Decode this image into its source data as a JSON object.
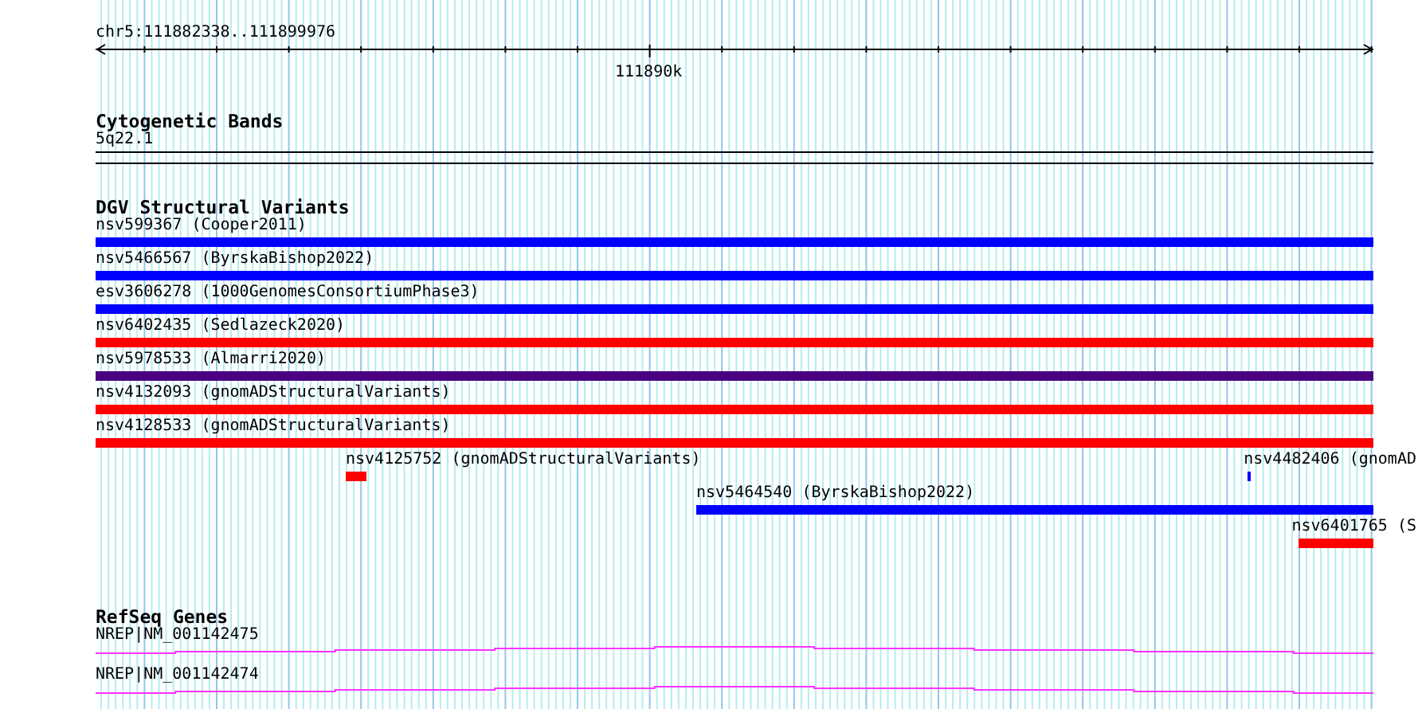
{
  "ruler": {
    "location": "chr5:111882338..111899976",
    "tick_label": "111890k"
  },
  "cytogenetic_bands": {
    "title": "Cytogenetic Bands",
    "band": "5q22.1"
  },
  "dgv_structural_variants": {
    "title": "DGV Structural Variants",
    "features": [
      {
        "label": "nsv599367 (Cooper2011)",
        "color": "#0000ff"
      },
      {
        "label": "nsv5466567 (ByrskaBishop2022)",
        "color": "#0000ff"
      },
      {
        "label": "esv3606278 (1000GenomesConsortiumPhase3)",
        "color": "#0000ff"
      },
      {
        "label": "nsv6402435 (Sedlazeck2020)",
        "color": "#ff0000"
      },
      {
        "label": "nsv5978533 (Almarri2020)",
        "color": "#4b0082"
      },
      {
        "label": "nsv4132093 (gnomADStructuralVariants)",
        "color": "#ff0000"
      },
      {
        "label": "nsv4128533 (gnomADStructuralVariants)",
        "color": "#ff0000"
      },
      {
        "label": "nsv4125752 (gnomADStructuralVariants)",
        "color": "#ff0000"
      },
      {
        "label": "nsv4482406 (gnomAD",
        "color": "#0000ff"
      },
      {
        "label": "nsv5464540 (ByrskaBishop2022)",
        "color": "#0000ff"
      },
      {
        "label": "nsv6401765 (S",
        "color": "#ff0000"
      }
    ]
  },
  "refseq_genes": {
    "title": "RefSeq Genes",
    "genes": [
      {
        "label": "NREP|NM_001142475"
      },
      {
        "label": "NREP|NM_001142474"
      }
    ]
  }
}
